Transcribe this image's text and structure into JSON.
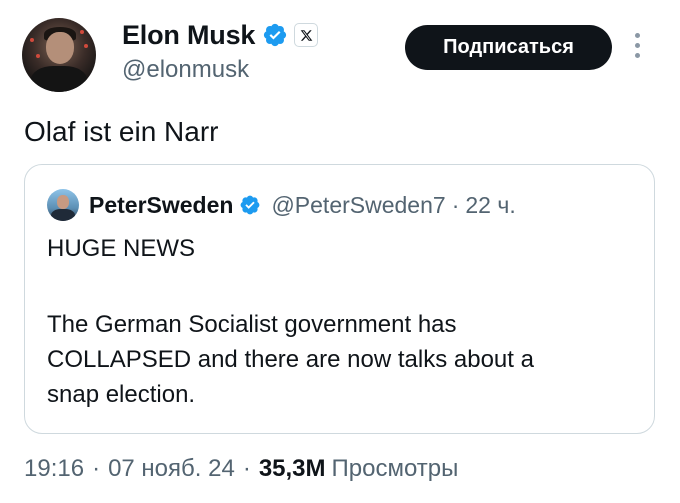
{
  "author": {
    "display_name": "Elon Musk",
    "handle": "@elonmusk"
  },
  "follow_label": "Подписаться",
  "tweet_text": "Olaf ist ein Narr",
  "quote": {
    "display_name": "PeterSweden",
    "handle": "@PeterSweden7",
    "separator": "·",
    "time": "22 ч.",
    "lines": [
      "HUGE NEWS",
      "The German Socialist government has",
      "COLLAPSED and there are now talks about a",
      "snap election."
    ]
  },
  "footer": {
    "time": "19:16",
    "dot1": "·",
    "date": "07 нояб. 24",
    "dot2": "·",
    "views": "35,3M",
    "views_label": "Просмотры"
  },
  "colors": {
    "verified": "#1d9bf0",
    "text_primary": "#0f1419",
    "text_secondary": "#536471",
    "border": "#cfd9de"
  },
  "icons": [
    "verified-badge-icon",
    "x-logo-icon",
    "more-options-icon"
  ]
}
